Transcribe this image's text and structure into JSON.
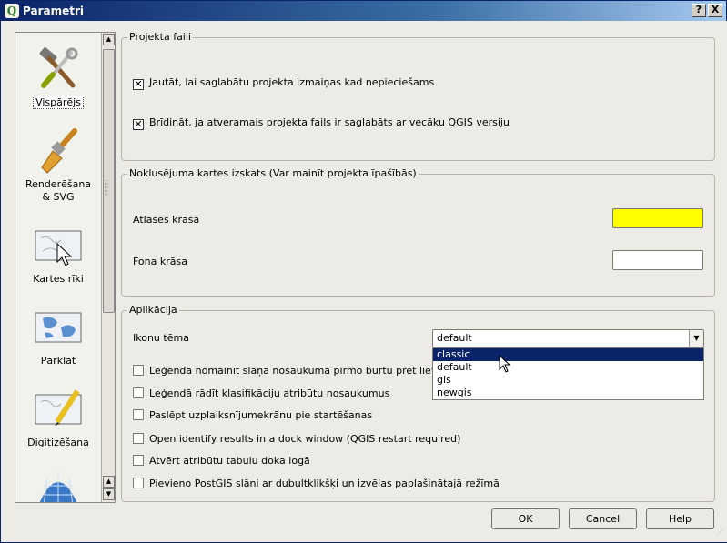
{
  "window": {
    "title": "Parametri",
    "app_icon": "Q",
    "help_btn": "?",
    "close_btn": "X"
  },
  "sidebar": {
    "items": [
      {
        "label": "Vispārējs",
        "icon": "tools-icon",
        "selected": true
      },
      {
        "label": "Renderēšana & SVG",
        "icon": "paintbrush-icon",
        "selected": false
      },
      {
        "label": "Kartes rīki",
        "icon": "map-cursor-icon",
        "selected": false
      },
      {
        "label": "Pārklāt",
        "icon": "map-overlay-icon",
        "selected": false
      },
      {
        "label": "Digitizēšana",
        "icon": "map-pencil-icon",
        "selected": false
      },
      {
        "label": "",
        "icon": "globe-grid-icon",
        "selected": false
      }
    ]
  },
  "project_files": {
    "title": "Projekta faili",
    "prompt_save": {
      "label": "Jautāt, lai saglabātu projekta izmaiņas kad nepieciešams",
      "checked": true
    },
    "warn_older": {
      "label": "Brīdināt, ja atveramais projekta fails ir saglabāts ar vecāku QGIS versiju",
      "checked": true
    }
  },
  "map_defaults": {
    "title": "Noklusējuma kartes izskats (Var mainīt projekta īpašībās)",
    "selection_color_label": "Atlases krāsa",
    "selection_color": "#ffff00",
    "background_color_label": "Fona krāsa",
    "background_color": "#ffffff"
  },
  "application": {
    "title": "Aplikācija",
    "icon_theme_label": "Ikonu tēma",
    "icon_theme_value": "default",
    "theme_options": [
      "classic",
      "default",
      "gis",
      "newgis"
    ],
    "highlighted_option": "classic",
    "options": [
      {
        "label": "Leģendā nomainīt slāņa nosaukuma pirmo burtu pret lieto burtu",
        "checked": false
      },
      {
        "label": "Leģendā rādīt klasifikāciju atribūtu nosaukumus",
        "checked": false
      },
      {
        "label": "Paslēpt uzplaiksnījumekrānu pie startēšanas",
        "checked": false
      },
      {
        "label": "Open identify results in a dock window (QGIS restart required)",
        "checked": false
      },
      {
        "label": "Atvērt atribūtu tabulu doka logā",
        "checked": false
      },
      {
        "label": "Pievieno PostGIS slāni ar dubultklikšķi un izvēlas paplašinātajā režīmā",
        "checked": false
      }
    ]
  },
  "buttons": {
    "ok": "OK",
    "cancel": "Cancel",
    "help": "Help"
  }
}
